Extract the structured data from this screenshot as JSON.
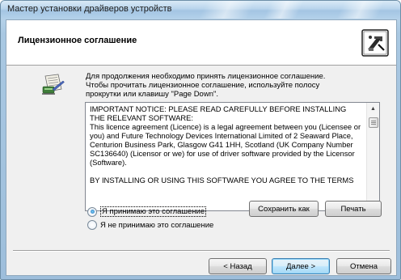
{
  "window": {
    "title": "Мастер установки драйверов устройств"
  },
  "header": {
    "title": "Лицензионное соглашение",
    "icon": "driver-wizard-icon"
  },
  "intro": {
    "icon": "license-agreement-icon",
    "lines": [
      "Для продолжения необходимо принять лицензионное соглашение.",
      "Чтобы прочитать лицензионное соглашение, используйте полосу",
      "прокрутки или клавишу \"Page Down\"."
    ]
  },
  "license": {
    "lines": [
      "IMPORTANT NOTICE: PLEASE READ CAREFULLY BEFORE INSTALLING",
      "THE RELEVANT SOFTWARE:",
      "This licence agreement (Licence) is a legal agreement between you (Licensee or",
      "you) and Future Technology Devices International Limited of 2 Seaward Place,",
      "Centurion Business Park, Glasgow G41 1HH, Scotland (UK Company Number",
      "SC136640) (Licensor or we) for use of driver software provided by the Licensor",
      "(Software).",
      "",
      "BY INSTALLING OR USING THIS SOFTWARE YOU AGREE TO THE TERMS"
    ]
  },
  "options": {
    "accept": {
      "label": "Я принимаю это соглашение",
      "selected": true
    },
    "decline": {
      "label": "Я не принимаю это соглашение",
      "selected": false
    }
  },
  "buttons": {
    "save_as": "Сохранить как",
    "print": "Печать",
    "back": "< Назад",
    "next": "Далее >",
    "cancel": "Отмена"
  },
  "colors": {
    "window_frame": "#a9c8e2",
    "dialog_background": "#f0f0f0",
    "default_button_border": "#3c7fb1"
  }
}
